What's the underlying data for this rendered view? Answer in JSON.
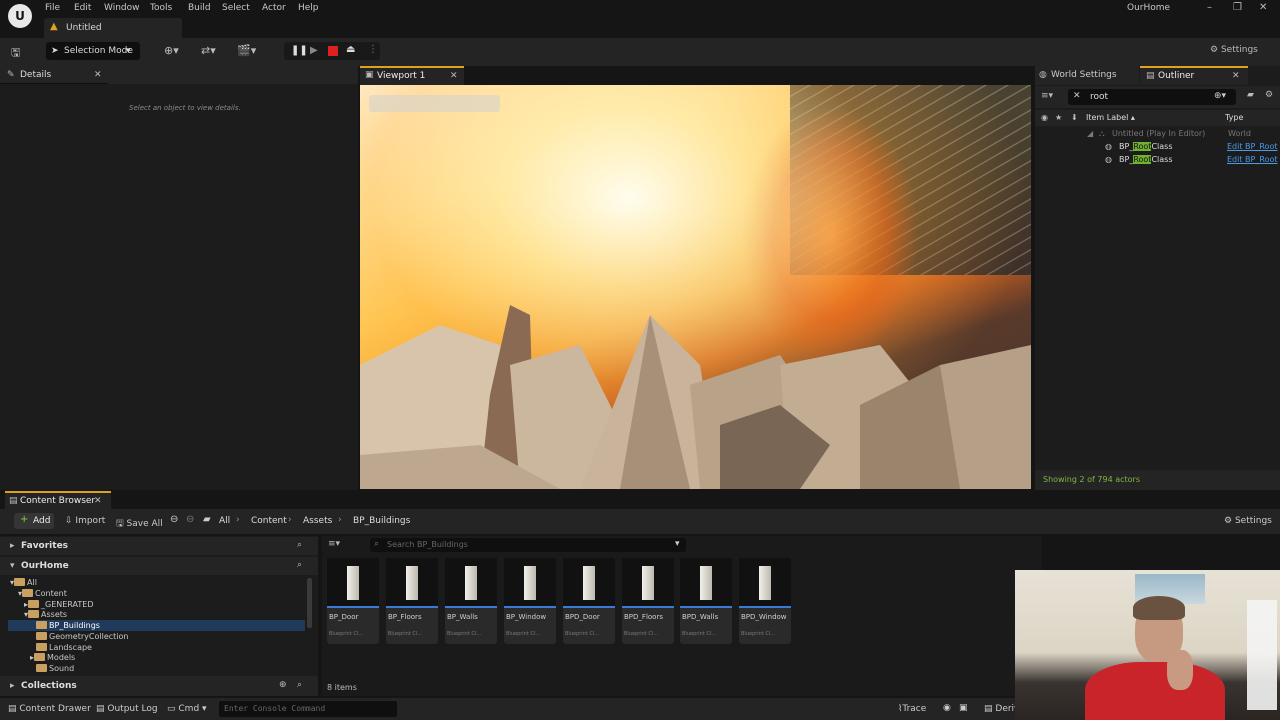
{
  "app": {
    "logo_text": "U",
    "project": "OurHome",
    "menu": [
      "File",
      "Edit",
      "Window",
      "Tools",
      "Build",
      "Select",
      "Actor",
      "Help"
    ],
    "doc_tab": "Untitled",
    "window_controls": [
      "–",
      "❐",
      "✕"
    ]
  },
  "toolbar": {
    "selection_mode": "Selection Mode",
    "settings": "Settings"
  },
  "details": {
    "tab": "Details",
    "hint": "Select an object to view details."
  },
  "viewport": {
    "tab": "Viewport 1"
  },
  "right_panel": {
    "tabs": [
      "World Settings",
      "Outliner"
    ],
    "search_value": "root",
    "columns": {
      "label": "Item Label ▴",
      "type": "Type"
    },
    "world_row": {
      "label": "Untitled (Play In Editor)",
      "type": "World"
    },
    "rows": [
      {
        "prefix": "BP_",
        "highlight": "Root",
        "suffix": "Class",
        "type": "Edit BP_Root"
      },
      {
        "prefix": "BP_",
        "highlight": "Root",
        "suffix": "Class",
        "type": "Edit BP_Root"
      }
    ],
    "footer": "Showing 2 of 794 actors"
  },
  "content_browser": {
    "tab": "Content Browser",
    "toolbar": {
      "add": "Add",
      "import": "Import",
      "save_all": "Save All",
      "breadcrumb": [
        "All",
        "Content",
        "Assets",
        "BP_Buildings"
      ],
      "settings": "Settings"
    },
    "favorites": "Favorites",
    "project_section": "OurHome",
    "collections": "Collections",
    "tree": [
      "All",
      "Content",
      "_GENERATED",
      "Assets",
      "BP_Buildings",
      "GeometryCollection",
      "Landscape",
      "Models",
      "Sound"
    ],
    "search_placeholder": "Search BP_Buildings",
    "assets": [
      {
        "name": "BP_Door",
        "type": "Blueprint Cl..."
      },
      {
        "name": "BP_Floors",
        "type": "Blueprint Cl..."
      },
      {
        "name": "BP_Walls",
        "type": "Blueprint Cl..."
      },
      {
        "name": "BP_Window",
        "type": "Blueprint Cl..."
      },
      {
        "name": "BPD_Door",
        "type": "Blueprint Cl..."
      },
      {
        "name": "BPD_Floors",
        "type": "Blueprint Cl..."
      },
      {
        "name": "BPD_Walls",
        "type": "Blueprint Cl..."
      },
      {
        "name": "BPD_Window",
        "type": "Blueprint Cl..."
      }
    ],
    "item_count": "8 items"
  },
  "statusbar": {
    "content_drawer": "Content Drawer",
    "output_log": "Output Log",
    "cmd": "Cmd",
    "console_placeholder": "Enter Console Command",
    "trace": "Trace",
    "derived": "Deriv"
  },
  "colors": {
    "accent": "#e0a020",
    "highlight": "#6fb330",
    "link": "#4a9be8",
    "selection": "#1f3a5a"
  }
}
